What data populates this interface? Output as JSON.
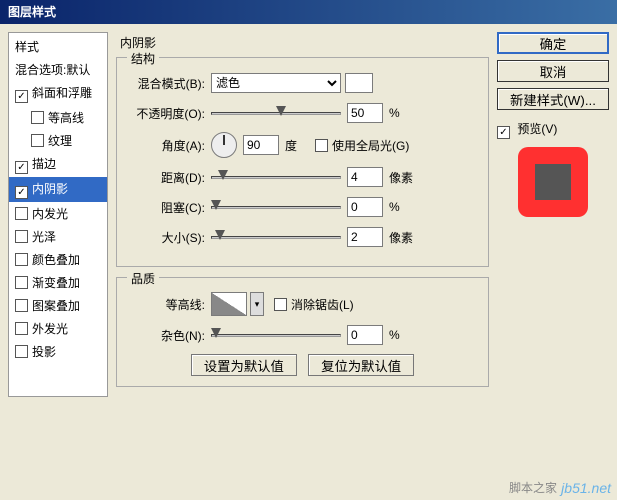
{
  "title": "图层样式",
  "sidebar": {
    "items": [
      {
        "label": "样式",
        "checked": null
      },
      {
        "label": "混合选项:默认",
        "checked": null
      },
      {
        "label": "斜面和浮雕",
        "checked": true
      },
      {
        "label": "等高线",
        "checked": false,
        "indent": true
      },
      {
        "label": "纹理",
        "checked": false,
        "indent": true
      },
      {
        "label": "描边",
        "checked": true
      },
      {
        "label": "内阴影",
        "checked": true,
        "selected": true
      },
      {
        "label": "内发光",
        "checked": false
      },
      {
        "label": "光泽",
        "checked": false
      },
      {
        "label": "颜色叠加",
        "checked": false
      },
      {
        "label": "渐变叠加",
        "checked": false
      },
      {
        "label": "图案叠加",
        "checked": false
      },
      {
        "label": "外发光",
        "checked": false
      },
      {
        "label": "投影",
        "checked": false
      }
    ]
  },
  "main": {
    "panel_title": "内阴影",
    "structure": {
      "title": "结构",
      "blend_mode": {
        "label": "混合模式(B):",
        "value": "滤色"
      },
      "opacity": {
        "label": "不透明度(O):",
        "value": "50",
        "unit": "%",
        "pos": 50
      },
      "angle": {
        "label": "角度(A):",
        "value": "90",
        "unit": "度",
        "global_label": "使用全局光(G)",
        "global": false
      },
      "distance": {
        "label": "距离(D):",
        "value": "4",
        "unit": "像素",
        "pos": 5
      },
      "choke": {
        "label": "阻塞(C):",
        "value": "0",
        "unit": "%",
        "pos": 0
      },
      "size": {
        "label": "大小(S):",
        "value": "2",
        "unit": "像素",
        "pos": 3
      }
    },
    "quality": {
      "title": "品质",
      "contour": {
        "label": "等高线:",
        "aa_label": "消除锯齿(L)",
        "aa": false
      },
      "noise": {
        "label": "杂色(N):",
        "value": "0",
        "unit": "%",
        "pos": 0
      }
    },
    "set_default": "设置为默认值",
    "reset_default": "复位为默认值"
  },
  "right": {
    "ok": "确定",
    "cancel": "取消",
    "new_style": "新建样式(W)...",
    "preview_label": "预览(V)",
    "preview_checked": true
  },
  "watermark1": "脚本之家",
  "watermark2": "jb51.net"
}
